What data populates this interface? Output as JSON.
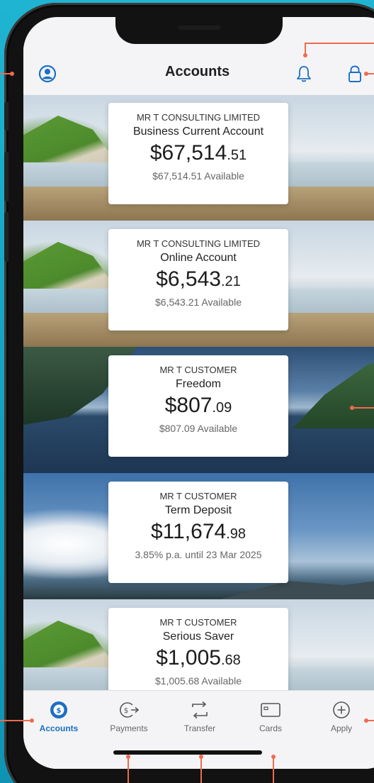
{
  "header": {
    "title": "Accounts"
  },
  "accounts": [
    {
      "owner": "MR T CONSULTING LIMITED",
      "name": "Business Current Account",
      "balance_dollars": "$67,514",
      "balance_cents": ".51",
      "sub": "$67,514.51 Available",
      "background": "coast"
    },
    {
      "owner": "MR T CONSULTING LIMITED",
      "name": "Online Account",
      "balance_dollars": "$6,543",
      "balance_cents": ".21",
      "sub": "$6,543.21 Available",
      "background": "coast"
    },
    {
      "owner": "MR T CUSTOMER",
      "name": "Freedom",
      "balance_dollars": "$807",
      "balance_cents": ".09",
      "sub": "$807.09 Available",
      "background": "lake"
    },
    {
      "owner": "MR T CUSTOMER",
      "name": "Term Deposit",
      "balance_dollars": "$11,674",
      "balance_cents": ".98",
      "sub": "3.85% p.a. until 23 Mar 2025",
      "background": "sky"
    },
    {
      "owner": "MR T CUSTOMER",
      "name": "Serious Saver",
      "balance_dollars": "$1,005",
      "balance_cents": ".68",
      "sub": "$1,005.68 Available",
      "background": "coast"
    }
  ],
  "tabs": [
    {
      "label": "Accounts",
      "icon": "dollar-circle-icon",
      "active": true
    },
    {
      "label": "Payments",
      "icon": "payment-arrow-icon",
      "active": false
    },
    {
      "label": "Transfer",
      "icon": "transfer-icon",
      "active": false
    },
    {
      "label": "Cards",
      "icon": "card-icon",
      "active": false
    },
    {
      "label": "Apply",
      "icon": "plus-circle-icon",
      "active": false
    }
  ],
  "colors": {
    "accent": "#1b6fc4",
    "callout": "#f06a4d",
    "backdrop": "#1aa3c3"
  }
}
